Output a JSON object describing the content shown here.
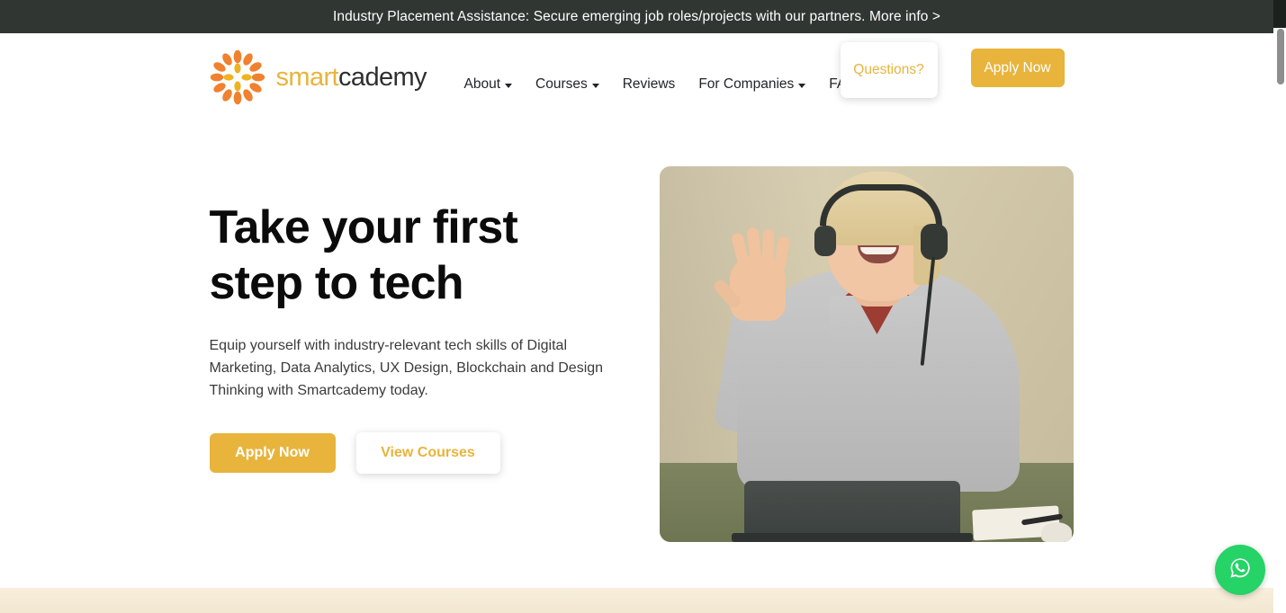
{
  "announcement": {
    "text": "Industry Placement Assistance: Secure emerging job roles/projects with our partners. More info >",
    "background": "#303733",
    "text_color": "#ffffff"
  },
  "header": {
    "logo": {
      "icon": "sunburst-logo-icon",
      "word_part_one": "smart",
      "word_part_two": "cademy",
      "color_primary": "#E8B43C",
      "color_secondary": "#2f2f2f"
    },
    "nav_items": [
      {
        "label": "About",
        "has_dropdown": true
      },
      {
        "label": "Courses",
        "has_dropdown": true
      },
      {
        "label": "Reviews",
        "has_dropdown": false
      },
      {
        "label": "For Companies",
        "has_dropdown": true
      },
      {
        "label": "FAQ",
        "has_dropdown": false
      }
    ],
    "questions_button": "Questions?",
    "apply_button": "Apply Now"
  },
  "hero": {
    "title_line_1": "Take your first",
    "title_line_2": "step to tech",
    "subtitle": "Equip yourself with industry-relevant tech skills of Digital Marketing, Data Analytics, UX Design, Blockchain and Design Thinking with Smartcademy today.",
    "primary_cta": "Apply Now",
    "secondary_cta": "View Courses",
    "image_alt": "Smiling student wearing headphones waving at a laptop during an online class"
  },
  "floating": {
    "whatsapp_icon": "whatsapp-icon",
    "whatsapp_color": "#25D366"
  },
  "colors": {
    "accent_gold": "#E8B43C",
    "banner_dark": "#303733",
    "cream_band": "#F8EFDC"
  }
}
